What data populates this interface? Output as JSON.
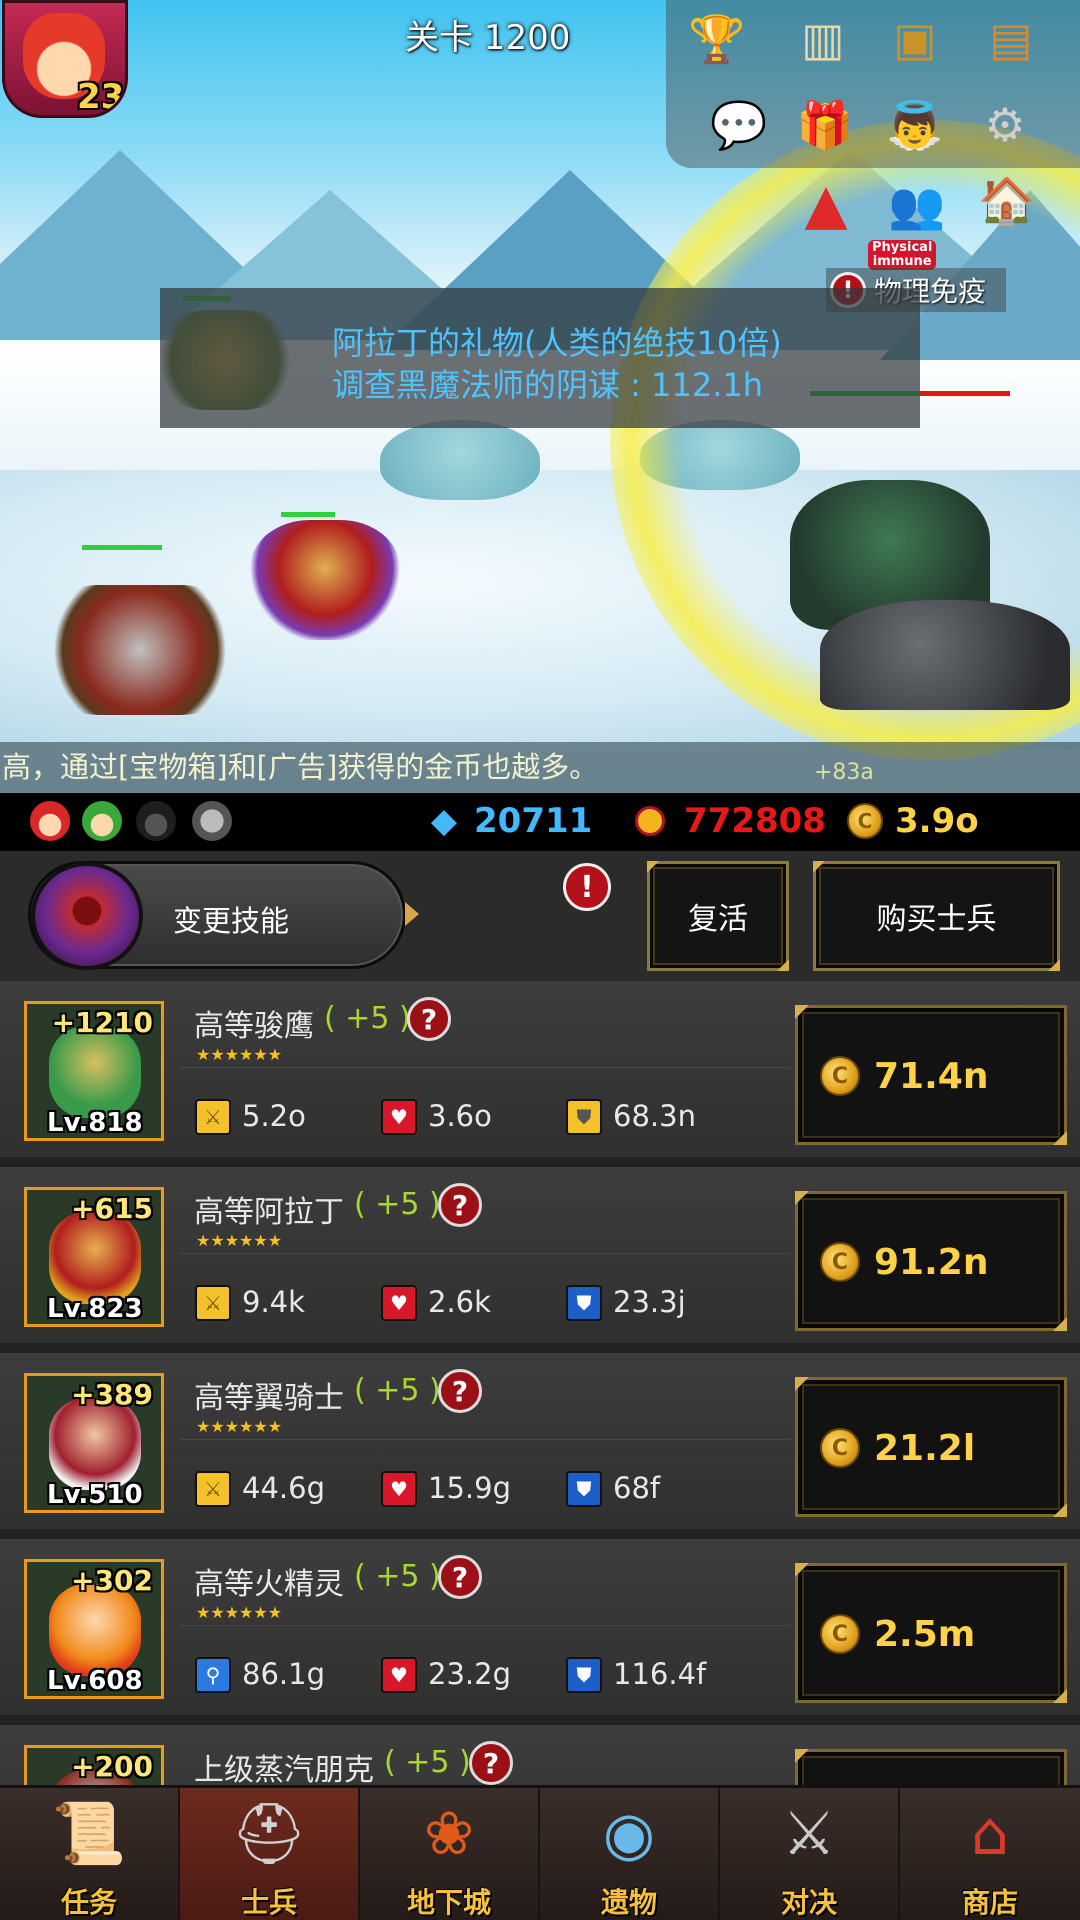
{
  "hero": {
    "level": "23"
  },
  "stage": {
    "label": "关卡 1200"
  },
  "top_menu": {
    "icons": [
      "trophy-icon",
      "ranking-podium-icon",
      "knight-helmet-book-icon",
      "sword-book-icon",
      "chat-bubble-icon",
      "gift-box-icon",
      "angel-icon",
      "settings-gear-icon",
      "arrow-up-triangle-icon",
      "players-icon",
      "mailbox-house-icon"
    ]
  },
  "boss": {
    "immune_badge_line1": "Physical",
    "immune_badge_line2": "immune",
    "immune_text": "物理免疫"
  },
  "quest": {
    "gift_line": "阿拉丁的礼物(人类的绝技10倍)",
    "investigate_line": "调查黑魔法师的阴谋 : 112.1h"
  },
  "ticker": {
    "text": "高，通过[宝物箱]和[广告]获得的金币也越多。",
    "gain": "+83a"
  },
  "currency": {
    "gems": "20711",
    "medals": "772808",
    "gold": "3.9o"
  },
  "actions": {
    "change_skill": "变更技能",
    "revive": "复活",
    "buy_soldier": "购买士兵"
  },
  "units": [
    {
      "name": "高等骏鹰",
      "plus": "( +5 )",
      "bonus": "+1210",
      "level": "Lv.818",
      "stars": "★★★★★★",
      "stat1": "5.2o",
      "stat2": "3.6o",
      "stat3": "68.3n",
      "price": "71.4n",
      "stat1_icon": "sword-icon",
      "stat3_icon": "gold-shield-icon"
    },
    {
      "name": "高等阿拉丁",
      "plus": "( +5 )",
      "bonus": "+615",
      "level": "Lv.823",
      "stars": "★★★★★★",
      "stat1": "9.4k",
      "stat2": "2.6k",
      "stat3": "23.3j",
      "price": "91.2n",
      "stat1_icon": "sword-icon",
      "stat3_icon": "blue-shield-icon"
    },
    {
      "name": "高等翼骑士",
      "plus": "( +5 )",
      "bonus": "+389",
      "level": "Lv.510",
      "stars": "★★★★★★",
      "stat1": "44.6g",
      "stat2": "15.9g",
      "stat3": "68f",
      "price": "21.2l",
      "stat1_icon": "sword-icon",
      "stat3_icon": "blue-shield-icon"
    },
    {
      "name": "高等火精灵",
      "plus": "( +5 )",
      "bonus": "+302",
      "level": "Lv.608",
      "stars": "★★★★★★",
      "stat1": "86.1g",
      "stat2": "23.2g",
      "stat3": "116.4f",
      "price": "2.5m",
      "stat1_icon": "magic-staff-icon",
      "stat3_icon": "blue-shield-icon"
    },
    {
      "name": "上级蒸汽朋克",
      "plus": "( +5 )",
      "bonus": "+200"
    }
  ],
  "tabs": [
    {
      "label": "任务",
      "icon": "scroll-icon",
      "active": false
    },
    {
      "label": "士兵",
      "icon": "soldier-helmet-icon",
      "active": true
    },
    {
      "label": "地下城",
      "icon": "monster-plant-icon",
      "active": false
    },
    {
      "label": "遗物",
      "icon": "crystal-orb-icon",
      "active": false
    },
    {
      "label": "对决",
      "icon": "crossed-swords-icon",
      "active": false
    },
    {
      "label": "商店",
      "icon": "shop-icon",
      "active": false
    }
  ]
}
